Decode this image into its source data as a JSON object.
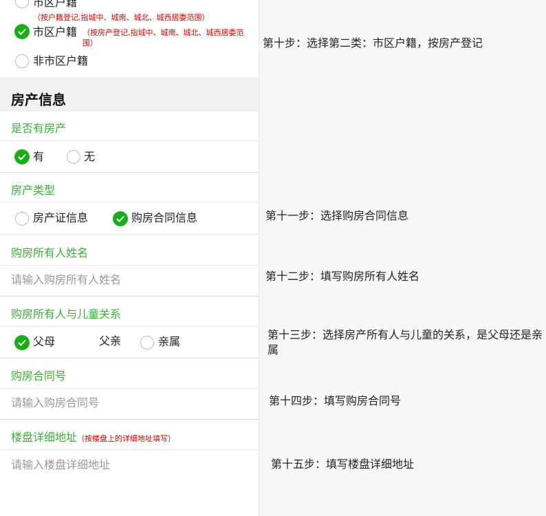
{
  "residency": {
    "opt_city_1": {
      "label": "市区户籍",
      "note": "（按户籍登记,指城中、城南、城北、城西居委范围）"
    },
    "opt_city_2": {
      "label": "市区户籍",
      "note": "（按房产登记,指城中、城南、城北、城西居委范围）"
    },
    "opt_noncity": {
      "label": "非市区户籍"
    },
    "selected": "opt_city_2"
  },
  "property": {
    "section_title": "房产信息",
    "has_property": {
      "label": "是否有房产",
      "options": [
        "有",
        "无"
      ],
      "selected": "有"
    },
    "property_type": {
      "label": "房产类型",
      "options": [
        "房产证信息",
        "购房合同信息"
      ],
      "selected": "购房合同信息"
    },
    "owner_name": {
      "label": "购房所有人姓名",
      "placeholder": "请输入购房所有人姓名"
    },
    "relation": {
      "label": "购房所有人与儿童关系",
      "options": [
        "父母",
        "亲属"
      ],
      "selected": "父母",
      "annotation": "父亲"
    },
    "contract_no": {
      "label": "购房合同号",
      "placeholder": "请输入购房合同号"
    },
    "address": {
      "label": "楼盘详细地址",
      "note": "（按楼盘上的详细地址填写）",
      "placeholder": "请输入楼盘详细地址"
    }
  },
  "steps": {
    "s10": "第十步：选择第二类：市区户籍，按房产登记",
    "s11": "第十一步：选择购房合同信息",
    "s12": "第十二步：填写购房所有人姓名",
    "s13": "第十三步：选择房产所有人与儿童的关系，是父母还是亲属",
    "s14": "第十四步：填写购房合同号",
    "s15": "第十五步：填写楼盘详细地址"
  },
  "colors": {
    "accent_green": "#1aad19",
    "label_green": "#3dae3d",
    "note_red": "#e00000"
  }
}
